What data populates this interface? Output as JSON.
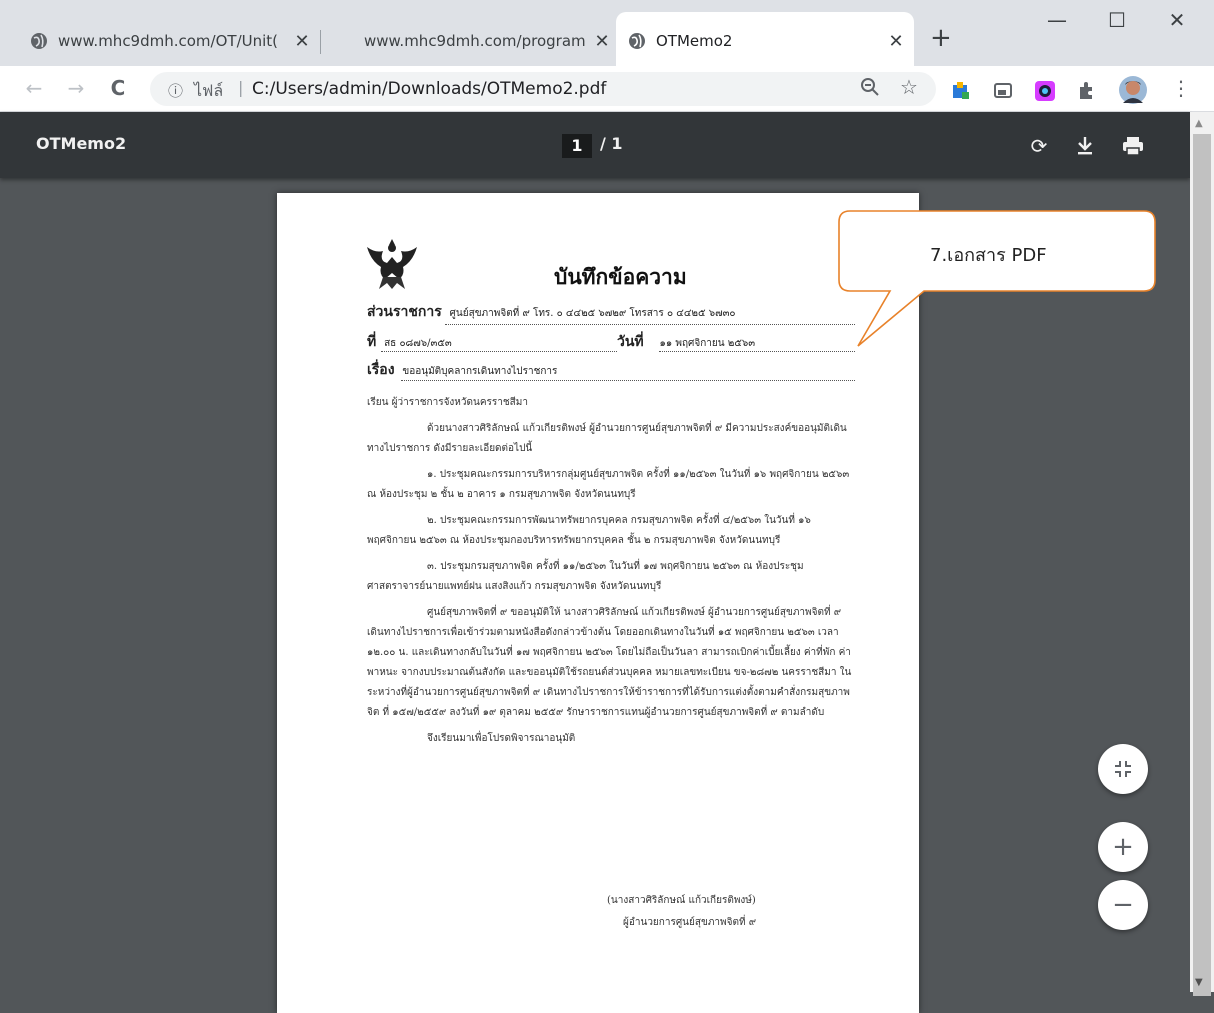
{
  "tabs": [
    {
      "title": "www.mhc9dmh.com/OT/Unit(",
      "close": "✕"
    },
    {
      "title": "www.mhc9dmh.com/program",
      "close": "✕"
    },
    {
      "title": "OTMemo2",
      "close": "✕"
    }
  ],
  "new_tab": "+",
  "window_controls": {
    "minimize": "—",
    "maximize": "☐",
    "close": "✕"
  },
  "toolbar": {
    "back": "←",
    "forward": "→",
    "reload": "C",
    "info": "ⓘ",
    "scheme": "ไฟล์",
    "separator": "|",
    "url": "C:/Users/admin/Downloads/OTMemo2.pdf",
    "zoom_icon": "zoom-out-icon",
    "star_icon": "bookmark-star-icon",
    "menu": "⋮"
  },
  "pdf_viewer": {
    "title": "OTMemo2",
    "current_page": "1",
    "total_pages": "/ 1",
    "rotate": "⟳",
    "download": "⭳",
    "print": "print-icon"
  },
  "memo": {
    "heading": "บันทึกข้อความ",
    "agency_label": "ส่วนราชการ",
    "agency_value": "ศูนย์สุขภาพจิตที่ ๙ โทร. ๐ ๔๔๒๕ ๖๗๒๙ โทรสาร ๐ ๔๔๒๕ ๖๗๓๐",
    "ref_label": "ที่",
    "ref_value": "สธ ๐๘๗๖/๓๕๓",
    "date_label": "วันที่",
    "date_value": "๑๑ พฤศจิกายน ๒๕๖๓",
    "subject_label": "เรื่อง",
    "subject_value": "ขออนุมัติบุคลากรเดินทางไปราชการ",
    "to": "เรียน  ผู้ว่าราชการจังหวัดนครราชสีมา",
    "para1": "ด้วยนางสาวศิริลักษณ์ แก้วเกียรติพงษ์ ผู้อำนวยการศูนย์สุขภาพจิตที่ ๙ มีความประสงค์ขออนุมัติเดินทางไปราชการ ดังมีรายละเอียดต่อไปนี้",
    "item1": "๑. ประชุมคณะกรรมการบริหารกลุ่มศูนย์สุขภาพจิต ครั้งที่ ๑๑/๒๕๖๓ ในวันที่ ๑๖ พฤศจิกายน ๒๕๖๓ ณ ห้องประชุม ๒ ชั้น ๒ อาคาร ๑ กรมสุขภาพจิต จังหวัดนนทบุรี",
    "item2": "๒. ประชุมคณะกรรมการพัฒนาทรัพยากรบุคคล กรมสุขภาพจิต ครั้งที่ ๔/๒๕๖๓ ในวันที่ ๑๖ พฤศจิกายน ๒๕๖๓ ณ ห้องประชุมกองบริหารทรัพยากรบุคคล ชั้น ๒ กรมสุขภาพจิต จังหวัดนนทบุรี",
    "item3": "๓. ประชุมกรมสุขภาพจิต ครั้งที่ ๑๑/๒๕๖๓ ในวันที่ ๑๗ พฤศจิกายน ๒๕๖๓ ณ ห้องประชุมศาสตราจารย์นายแพทย์ฝน แสงสิงแก้ว กรมสุขภาพจิต จังหวัดนนทบุรี",
    "para2": "ศูนย์สุขภาพจิตที่ ๙ ขออนุมัติให้ นางสาวศิริลักษณ์ แก้วเกียรติพงษ์ ผู้อำนวยการศูนย์สุขภาพจิตที่ ๙ เดินทางไปราชการเพื่อเข้าร่วมตามหนังสือดังกล่าวข้างต้น โดยออกเดินทางในวันที่ ๑๕ พฤศจิกายน ๒๕๖๓ เวลา ๑๒.๐๐ น. และเดินทางกลับในวันที่ ๑๗ พฤศจิกายน ๒๕๖๓ โดยไม่ถือเป็นวันลา สามารถเบิกค่าเบี้ยเลี้ยง ค่าที่พัก ค่าพาหนะ จากงบประมาณต้นสังกัด และขออนุมัติใช้รถยนต์ส่วนบุคคล หมายเลขทะเบียน ขจ-๒๘๗๒ นครราชสีมา ในระหว่างที่ผู้อำนวยการศูนย์สุขภาพจิตที่ ๙ เดินทางไปราชการให้ข้าราชการที่ได้รับการแต่งตั้งตามคำสั่งกรมสุขภาพจิต ที่ ๑๕๗/๒๕๕๙ ลงวันที่ ๑๙ ตุลาคม ๒๕๕๙ รักษาราชการแทนผู้อำนวยการศูนย์สุขภาพจิตที่ ๙ ตามลำดับ",
    "closing": "จึงเรียนมาเพื่อโปรดพิจารณาอนุมัติ",
    "signer_name": "(นางสาวศิริลักษณ์ แก้วเกียรติพงษ์)",
    "signer_title": "ผู้อำนวยการศูนย์สุขภาพจิตที่ ๙"
  },
  "callout": {
    "text": "7.เอกสาร PDF"
  },
  "zoom_controls": {
    "fit": "fit-to-page-icon",
    "zoom_in": "+",
    "zoom_out": "−"
  },
  "colors": {
    "viewer_bg": "#525659",
    "pdf_bar": "#323639",
    "callout_border": "#e8822a",
    "tab_strip": "#dee1e6"
  }
}
